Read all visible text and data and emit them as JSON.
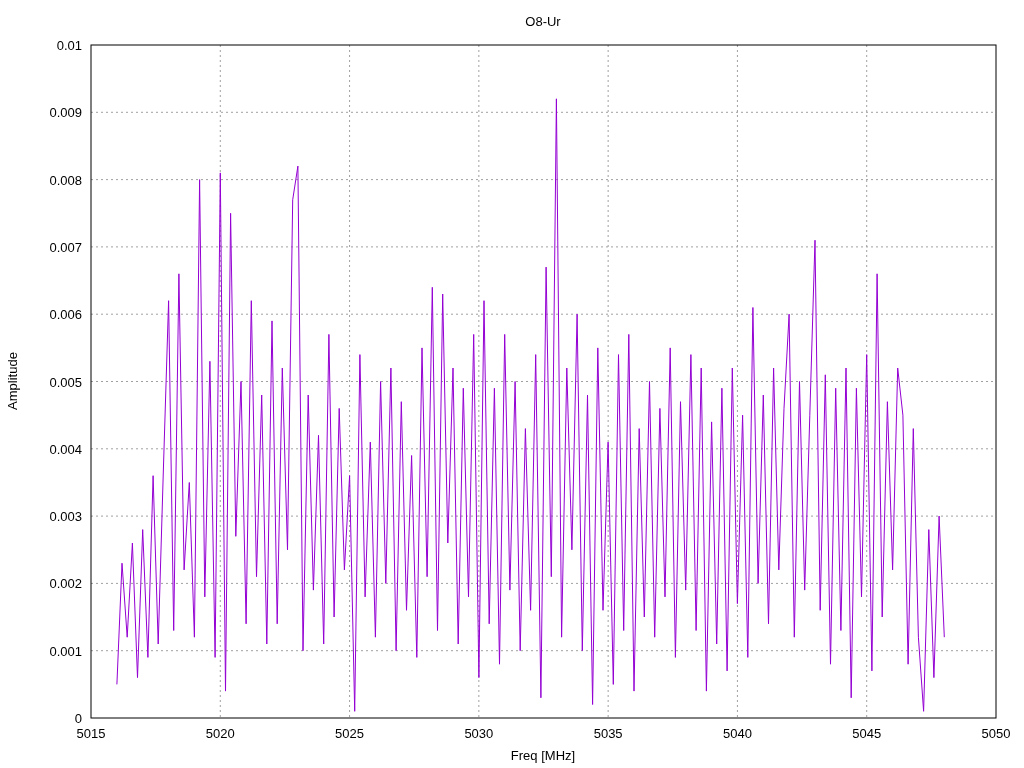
{
  "plot": {
    "chart_data": {
      "type": "line",
      "title": "O8-Ur",
      "xlabel": "Freq [MHz]",
      "ylabel": "Amplitude",
      "grid": true,
      "xlim": [
        5015,
        5050
      ],
      "ylim": [
        0,
        0.01
      ],
      "xticks": [
        5015,
        5020,
        5025,
        5030,
        5035,
        5040,
        5045,
        5050
      ],
      "yticks": [
        0.01,
        0.009,
        0.008,
        0.007,
        0.006,
        0.005,
        0.004,
        0.003,
        0.002,
        0.001,
        0
      ],
      "x": [
        5016,
        5016.2,
        5016.4,
        5016.6,
        5016.8,
        5017,
        5017.2,
        5017.4,
        5017.6,
        5017.8,
        5018,
        5018.2,
        5018.4,
        5018.6,
        5018.8,
        5019,
        5019.2,
        5019.4,
        5019.6,
        5019.8,
        5020,
        5020.2,
        5020.4,
        5020.6,
        5020.8,
        5021,
        5021.2,
        5021.4,
        5021.6,
        5021.8,
        5022,
        5022.2,
        5022.4,
        5022.6,
        5022.8,
        5023,
        5023.2,
        5023.4,
        5023.6,
        5023.8,
        5024,
        5024.2,
        5024.4,
        5024.6,
        5024.8,
        5025,
        5025.2,
        5025.4,
        5025.6,
        5025.8,
        5026,
        5026.2,
        5026.4,
        5026.6,
        5026.8,
        5027,
        5027.2,
        5027.4,
        5027.6,
        5027.8,
        5028,
        5028.2,
        5028.4,
        5028.6,
        5028.8,
        5029,
        5029.2,
        5029.4,
        5029.6,
        5029.8,
        5030,
        5030.2,
        5030.4,
        5030.6,
        5030.8,
        5031,
        5031.2,
        5031.4,
        5031.6,
        5031.8,
        5032,
        5032.2,
        5032.4,
        5032.6,
        5032.8,
        5033,
        5033.2,
        5033.4,
        5033.6,
        5033.8,
        5034,
        5034.2,
        5034.4,
        5034.6,
        5034.8,
        5035,
        5035.2,
        5035.4,
        5035.6,
        5035.8,
        5036,
        5036.2,
        5036.4,
        5036.6,
        5036.8,
        5037,
        5037.2,
        5037.4,
        5037.6,
        5037.8,
        5038,
        5038.2,
        5038.4,
        5038.6,
        5038.8,
        5039,
        5039.2,
        5039.4,
        5039.6,
        5039.8,
        5040,
        5040.2,
        5040.4,
        5040.6,
        5040.8,
        5041,
        5041.2,
        5041.4,
        5041.6,
        5041.8,
        5042,
        5042.2,
        5042.4,
        5042.6,
        5042.8,
        5043,
        5043.2,
        5043.4,
        5043.6,
        5043.8,
        5044,
        5044.2,
        5044.4,
        5044.6,
        5044.8,
        5045,
        5045.2,
        5045.4,
        5045.6,
        5045.8,
        5046,
        5046.2,
        5046.4,
        5046.6,
        5046.8,
        5047,
        5047.2,
        5047.4,
        5047.6,
        5047.8,
        5048
      ],
      "series": [
        {
          "color": "#9400d3",
          "values": [
            0.0005,
            0.0023,
            0.0012,
            0.0026,
            0.0006,
            0.0028,
            0.0009,
            0.0036,
            0.0011,
            0.0037,
            0.0062,
            0.0013,
            0.0066,
            0.0022,
            0.0035,
            0.0012,
            0.008,
            0.0018,
            0.0053,
            0.0009,
            0.0081,
            0.0004,
            0.0075,
            0.0027,
            0.005,
            0.0014,
            0.0062,
            0.0021,
            0.0048,
            0.0011,
            0.0059,
            0.0014,
            0.0052,
            0.0025,
            0.0077,
            0.0082,
            0.001,
            0.0048,
            0.0019,
            0.0042,
            0.0011,
            0.0057,
            0.0015,
            0.0046,
            0.0022,
            0.0036,
            0.0001,
            0.0054,
            0.0018,
            0.0041,
            0.0012,
            0.005,
            0.002,
            0.0052,
            0.001,
            0.0047,
            0.0016,
            0.0039,
            0.0009,
            0.0055,
            0.0021,
            0.0064,
            0.0013,
            0.0063,
            0.0026,
            0.0052,
            0.0011,
            0.0049,
            0.0018,
            0.0057,
            0.0006,
            0.0062,
            0.0014,
            0.0049,
            0.0008,
            0.0057,
            0.0019,
            0.005,
            0.001,
            0.0043,
            0.0016,
            0.0054,
            0.0003,
            0.0067,
            0.0021,
            0.0092,
            0.0012,
            0.0052,
            0.0025,
            0.006,
            0.001,
            0.0048,
            0.0002,
            0.0055,
            0.0016,
            0.0041,
            0.0005,
            0.0054,
            0.0013,
            0.0057,
            0.0004,
            0.0043,
            0.0015,
            0.005,
            0.0012,
            0.0046,
            0.0018,
            0.0055,
            0.0009,
            0.0047,
            0.0019,
            0.0054,
            0.0013,
            0.0052,
            0.0004,
            0.0044,
            0.0011,
            0.0049,
            0.0007,
            0.0052,
            0.0017,
            0.0045,
            0.0009,
            0.0061,
            0.002,
            0.0048,
            0.0014,
            0.0052,
            0.0022,
            0.0046,
            0.006,
            0.0012,
            0.005,
            0.0019,
            0.0045,
            0.0071,
            0.0016,
            0.0051,
            0.0008,
            0.0049,
            0.0013,
            0.0052,
            0.0003,
            0.0049,
            0.0018,
            0.0054,
            0.0007,
            0.0066,
            0.0015,
            0.0047,
            0.0022,
            0.0052,
            0.0045,
            0.0008,
            0.0043,
            0.0012,
            0.0001,
            0.0028,
            0.0006,
            0.003,
            0.0012
          ]
        }
      ]
    }
  }
}
